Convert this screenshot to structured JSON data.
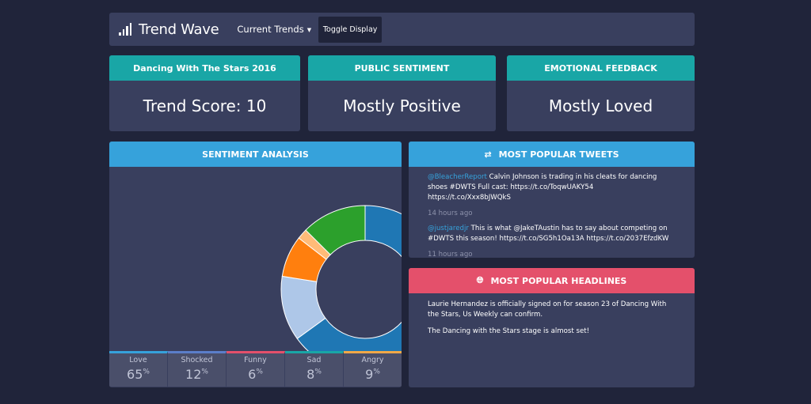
{
  "nav": {
    "brand": "Trend Wave",
    "dropdown": "Current Trends",
    "toggle": "Toggle Display"
  },
  "top_cards": [
    {
      "header": "Dancing With The Stars 2016",
      "value": "Trend Score: 10"
    },
    {
      "header": "PUBLIC SENTIMENT",
      "value": "Mostly Positive"
    },
    {
      "header": "EMOTIONAL FEEDBACK",
      "value": "Mostly Loved"
    }
  ],
  "sentiment": {
    "header": "SENTIMENT ANALYSIS",
    "legend": [
      {
        "label": "Love",
        "value": "65",
        "unit": "%",
        "color": "#36a2db"
      },
      {
        "label": "Shocked",
        "value": "12",
        "unit": "%",
        "color": "#5b7ec9"
      },
      {
        "label": "Funny",
        "value": "6",
        "unit": "%",
        "color": "#e4506b"
      },
      {
        "label": "Sad",
        "value": "8",
        "unit": "%",
        "color": "#19a6a6"
      },
      {
        "label": "Angry",
        "value": "9",
        "unit": "%",
        "color": "#f0a848"
      }
    ]
  },
  "chart_data": {
    "type": "pie",
    "slices": [
      {
        "value": 0.65,
        "color": "#1f77b4"
      },
      {
        "value": 0.125,
        "color": "#aec7e8"
      },
      {
        "value": 0.08,
        "color": "#ff7f0e"
      },
      {
        "value": 0.02,
        "color": "#ffbb78"
      },
      {
        "value": 0.125,
        "color": "#2ca02c"
      }
    ]
  },
  "tweets": {
    "header": "MOST POPULAR TWEETS",
    "items": [
      {
        "handle": "@BleacherReport",
        "text": " Calvin Johnson is trading in his cleats for dancing shoes #DWTS Full cast: https://t.co/ToqwUAKY54 https://t.co/Xxx8bJWQkS",
        "time": "14 hours ago"
      },
      {
        "handle": "@justjaredjr",
        "text": " This is what @JakeTAustin has to say about competing on #DWTS this season! https://t.co/SG5h1Oa13A https://t.co/2037EfzdKW",
        "time": "11 hours ago"
      }
    ]
  },
  "headlines": {
    "header": "MOST POPULAR HEADLINES",
    "items": [
      "Laurie Hernandez is officially signed on for season 23 of Dancing With the Stars, Us Weekly can confirm.",
      "The Dancing with the Stars stage is almost set!"
    ]
  }
}
